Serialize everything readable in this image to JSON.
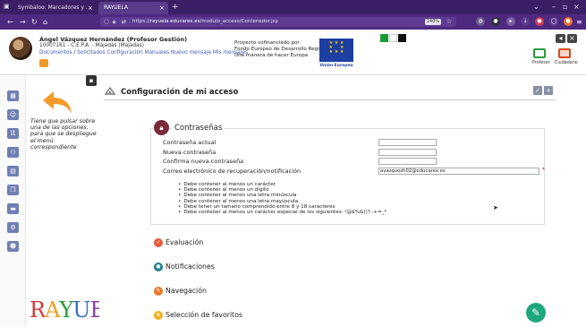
{
  "browser": {
    "tabs": [
      {
        "label": "Symbaloo: Marcadores y ...",
        "active": false
      },
      {
        "label": "RAYUELA",
        "active": true
      }
    ],
    "url_prefix": "https://",
    "url_domain": "rayuela.educarex.es",
    "url_path": "/modulo_acceso/Contenedor.jsp",
    "zoom": "140%"
  },
  "header": {
    "user_name": "Ángel Vázquez Hernández (Profesor Gestión)",
    "center": "10007161 - C.E.P.A. - Majadas (Majadas)",
    "menu": [
      "Documentos",
      "Solicitados",
      "Configuración",
      "Manuales",
      "Nuevo mensaje",
      "Mis mensajes"
    ],
    "menu_separator": "/",
    "project_line1": "Proyecto cofinanciado por",
    "project_line2": "Fondo Europeo de Desarrollo Regional",
    "project_line3": "Una manera de hacer Europa",
    "eu_caption": "Unión Europea",
    "roles": [
      "Profesor",
      "Ciudadano"
    ]
  },
  "sidebar": {
    "help_text": "Tiene que pulsar sobre una de las opciones, para que se despliegue el menú correspondiente",
    "logo": "RAYUELA",
    "icons": [
      "school-icon",
      "student-icon",
      "text-icon",
      "group-icon",
      "calendar-icon",
      "documents-icon",
      "messages-icon",
      "settings-icon",
      "user-icon"
    ]
  },
  "page": {
    "title": "Configuración de mi acceso",
    "passwords": {
      "title": "Contraseñas",
      "fields": [
        {
          "label": "Contraseña actual",
          "value": ""
        },
        {
          "label": "Nueva contraseña",
          "value": ""
        },
        {
          "label": "Confirma nueva contraseña",
          "value": ""
        },
        {
          "label": "Correo electrónico de recuperación/notificación",
          "value": "avazquezh02@educarex.es"
        }
      ],
      "required_mark": "*",
      "rules": [
        "Debe contener al menos un carácter",
        "Debe contener al menos un dígito",
        "Debe contener al menos una letra minúscula",
        "Debe contener al menos una letra mayúscula",
        "Debe tener un tamaño comprendido entre 8 y 18 caracteres",
        "Debe contener al menos un carácter especial de los siguientes: !@$%&()?.:+=_*"
      ]
    },
    "sections": [
      {
        "label": "Evaluación",
        "color": "#e85a3a"
      },
      {
        "label": "Notificaciones",
        "color": "#1b7f8c"
      },
      {
        "label": "Navegación",
        "color": "#e67a2b"
      },
      {
        "label": "Selección de favoritos",
        "color": "#f0b31d"
      }
    ]
  },
  "colors": {
    "tabbar": "#3b1f66",
    "navbar": "#4d2a80",
    "link": "#3d5bb8",
    "fab": "#1ea77c",
    "sidebar_icon": "#6f7fb3"
  }
}
